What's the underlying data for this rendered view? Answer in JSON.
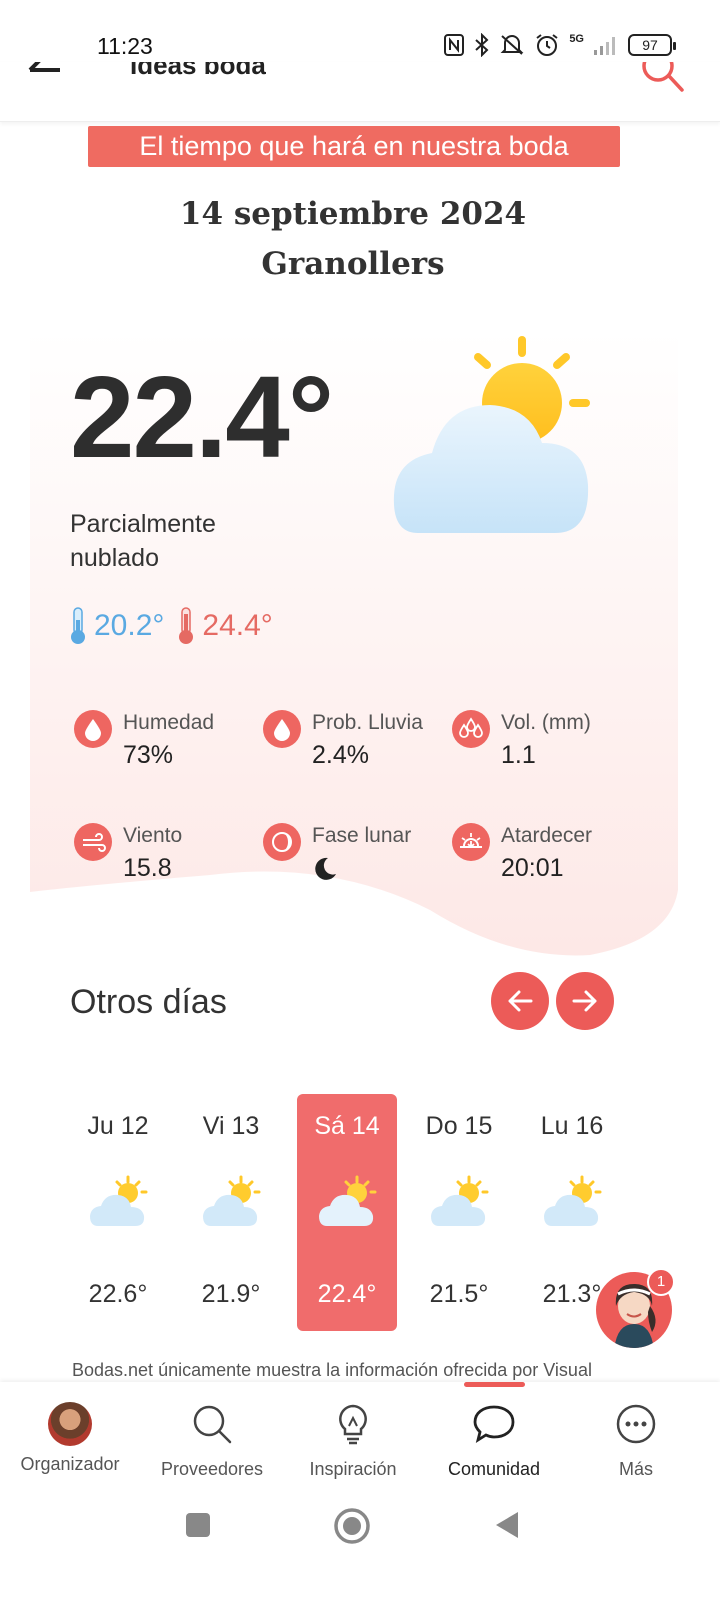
{
  "status_bar": {
    "time": "11:23",
    "network": "5G",
    "battery": "97"
  },
  "header": {
    "title": "Ideas boda"
  },
  "banner": "El tiempo que hará en nuestra boda",
  "event": {
    "date": "14 septiembre 2024",
    "city": "Granollers"
  },
  "current": {
    "temperature": "22.4°",
    "condition": "Parcialmente nublado",
    "min": "20.2°",
    "max": "24.4°",
    "icon": "partly-cloudy-icon"
  },
  "stats": [
    {
      "label": "Humedad",
      "value": "73%",
      "icon": "drop-icon"
    },
    {
      "label": "Prob. Lluvia",
      "value": "2.4%",
      "icon": "drop-icon"
    },
    {
      "label": "Vol. (mm)",
      "value": "1.1",
      "icon": "rain-drops-icon"
    },
    {
      "label": "Viento",
      "value": "15.8",
      "icon": "wind-icon"
    },
    {
      "label": "Fase lunar",
      "value": "",
      "icon": "moon-phase-icon"
    },
    {
      "label": "Atardecer",
      "value": "20:01",
      "icon": "sunset-icon"
    }
  ],
  "other_days": {
    "title": "Otros días",
    "days": [
      {
        "label": "Ju 12",
        "temp": "22.6°"
      },
      {
        "label": "Vi 13",
        "temp": "21.9°"
      },
      {
        "label": "Sá 14",
        "temp": "22.4°",
        "selected": true
      },
      {
        "label": "Do 15",
        "temp": "21.5°"
      },
      {
        "label": "Lu 16",
        "temp": "21.3°"
      }
    ]
  },
  "chat_badge": "1",
  "disclaimer": "Bodas.net únicamente muestra la información ofrecida por Visual",
  "bottom_nav": [
    {
      "label": "Organizador"
    },
    {
      "label": "Proveedores"
    },
    {
      "label": "Inspiración"
    },
    {
      "label": "Comunidad",
      "active": true
    },
    {
      "label": "Más"
    }
  ],
  "colors": {
    "accent": "#ec5b58",
    "min_temp": "#5aa9e2",
    "max_temp": "#e56a63"
  }
}
